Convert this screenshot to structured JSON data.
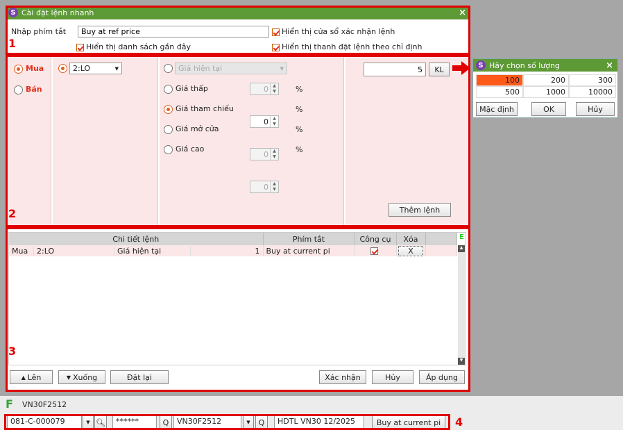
{
  "dialog": {
    "title": "Cài đặt lệnh nhanh",
    "close": "×",
    "shortcut_label": "Nhập phím tắt",
    "shortcut_value": "Buy at ref price",
    "chk_confirm": "Hiển thị cửa sổ xác nhận lệnh",
    "chk_recent": "Hiển thị danh sách gần đây",
    "chk_bar": "Hiển thị thanh đặt lệnh theo chỉ định"
  },
  "side": {
    "buy": "Mua",
    "sell": "Bán"
  },
  "order_type": {
    "value": "2:LO"
  },
  "price_options": {
    "current": "Giá hiện tại",
    "low": "Giá thấp",
    "ref": "Giá tham chiếu",
    "open": "Giá mở cửa",
    "high": "Giá cao",
    "low_val": "0",
    "ref_val": "0",
    "open_val": "0",
    "high_val": "0",
    "pct": "%"
  },
  "qty": {
    "value": "5",
    "button": "KL"
  },
  "add_button": "Thêm lệnh",
  "table": {
    "headers": [
      "Chi tiết lệnh",
      "Phím tắt",
      "Công cụ",
      "Xóa"
    ],
    "rows": [
      {
        "side": "Mua",
        "type": "2:LO",
        "price": "Giá hiện tại",
        "qty": "1",
        "shortcut": "Buy at current pi",
        "delete": "X"
      }
    ],
    "corner": "E"
  },
  "footer_buttons": {
    "up": "Lên",
    "down": "Xuống",
    "reset": "Đặt lại",
    "confirm": "Xác nhận",
    "cancel": "Hủy",
    "apply": "Áp dụng"
  },
  "labels": {
    "one": "1",
    "two": "2",
    "three": "3",
    "four": "4"
  },
  "qty_popup": {
    "title": "Hãy chọn số lượng",
    "close": "×",
    "values": [
      "100",
      "200",
      "300",
      "500",
      "1000",
      "10000"
    ],
    "default": "Mặc định",
    "ok": "OK",
    "cancel": "Hủy"
  },
  "bottom": {
    "tab_icon": "F",
    "tab_label": "VN30F2512",
    "account": "081-C-000079",
    "password": "******",
    "symbol": "VN30F2512",
    "contract": "HDTL VN30 12/2025",
    "quick_button": "Buy at current pi"
  },
  "colors": {
    "accent_green": "#5d9a35",
    "red": "#e00000",
    "selected_orange": "#ff5a1a"
  }
}
